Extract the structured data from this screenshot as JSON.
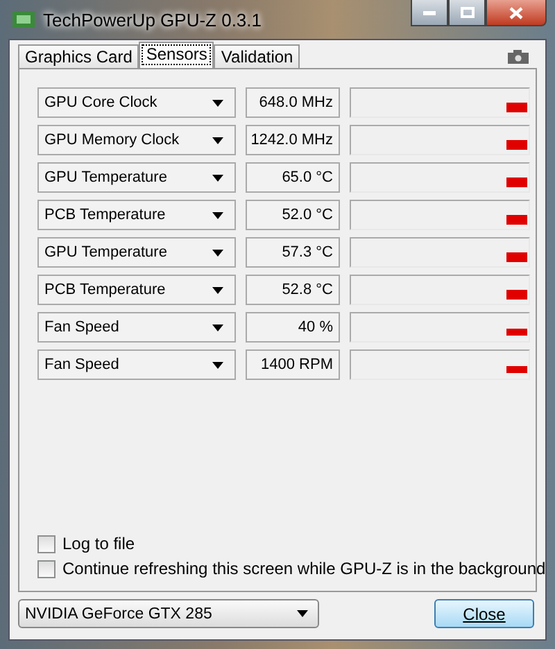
{
  "window": {
    "title": "TechPowerUp GPU-Z 0.3.1"
  },
  "tabs": [
    {
      "label": "Graphics Card",
      "selected": false
    },
    {
      "label": "Sensors",
      "selected": true
    },
    {
      "label": "Validation",
      "selected": false
    }
  ],
  "sensors": [
    {
      "name": "GPU Core Clock",
      "reading": "648.0 MHz"
    },
    {
      "name": "GPU Memory Clock",
      "reading": "1242.0 MHz"
    },
    {
      "name": "GPU Temperature",
      "reading": "65.0 °C"
    },
    {
      "name": "PCB Temperature",
      "reading": "52.0 °C"
    },
    {
      "name": "GPU Temperature",
      "reading": "57.3 °C"
    },
    {
      "name": "PCB Temperature",
      "reading": "52.8 °C"
    },
    {
      "name": "Fan Speed",
      "reading": "40 %"
    },
    {
      "name": "Fan Speed",
      "reading": "1400 RPM"
    }
  ],
  "options": [
    {
      "label": "Log to file",
      "checked": false
    },
    {
      "label": "Continue refreshing this screen while GPU-Z is in the background",
      "checked": false
    }
  ],
  "device": {
    "value": "NVIDIA GeForce GTX 285"
  },
  "close_button": {
    "label": "Close"
  }
}
